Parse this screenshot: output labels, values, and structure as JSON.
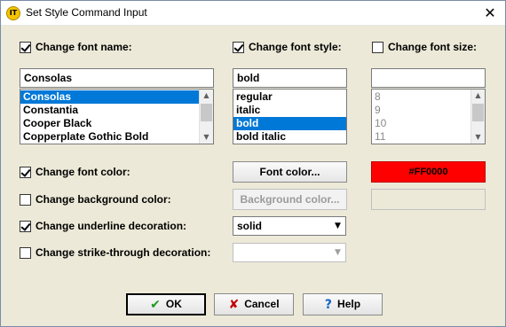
{
  "window": {
    "title": "Set Style Command Input",
    "app_icon_text": "IT",
    "close_glyph": "✕"
  },
  "font_name": {
    "checkbox_label": "Change font name:",
    "checked": true,
    "value": "Consolas",
    "list": [
      "Consolas",
      "Constantia",
      "Cooper Black",
      "Copperplate Gothic Bold"
    ],
    "selected_index": 0
  },
  "font_style": {
    "checkbox_label": "Change font style:",
    "checked": true,
    "value": "bold",
    "list": [
      "regular",
      "italic",
      "bold",
      "bold italic"
    ],
    "selected_index": 2
  },
  "font_size": {
    "checkbox_label": "Change font size:",
    "checked": false,
    "value": "",
    "list": [
      "8",
      "9",
      "10",
      "11"
    ]
  },
  "font_color": {
    "checkbox_label": "Change font color:",
    "checked": true,
    "button_label": "Font color...",
    "swatch_value": "#FF0000",
    "swatch_color": "#ff0000"
  },
  "background_color": {
    "checkbox_label": "Change background color:",
    "checked": false,
    "button_label": "Background color..."
  },
  "underline": {
    "checkbox_label": "Change underline decoration:",
    "checked": true,
    "selected": "solid"
  },
  "strike_through": {
    "checkbox_label": "Change strike-through decoration:",
    "checked": false,
    "selected": ""
  },
  "actions": {
    "ok_label": "OK",
    "cancel_label": "Cancel",
    "help_label": "Help",
    "ok_icon": "check-icon",
    "cancel_icon": "x-icon",
    "help_icon": "question-icon"
  }
}
